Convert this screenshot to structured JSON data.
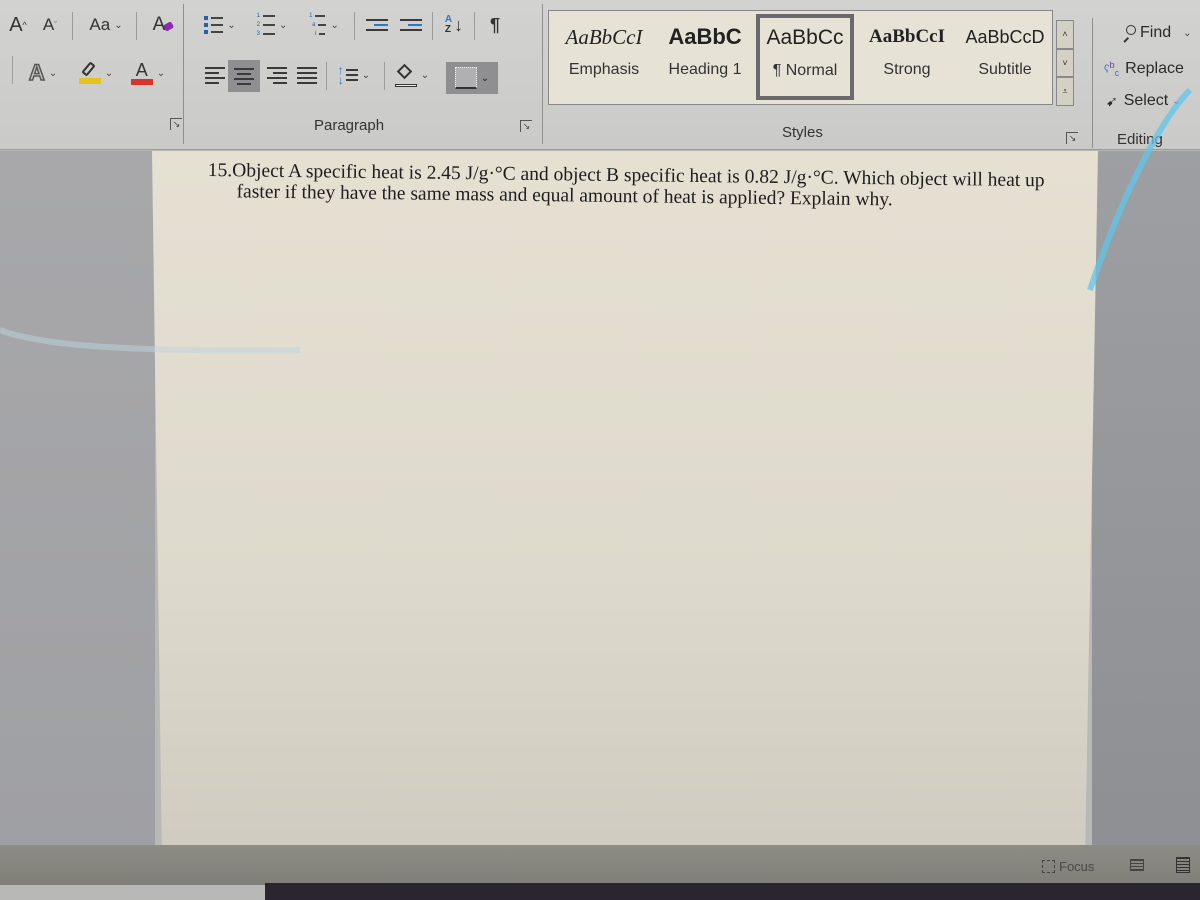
{
  "ribbon": {
    "font_group": {
      "grow_font": "A",
      "shrink_font": "A",
      "change_case": "Aa",
      "clear_formatting": "A",
      "text_effects": "A",
      "highlight_color": "#e6c21e",
      "font_color_letter": "A",
      "font_color": "#d9342b"
    },
    "paragraph_group": {
      "label": "Paragraph",
      "sort": "A Z ↓",
      "show_marks": "¶"
    },
    "styles_group": {
      "label": "Styles",
      "items": [
        {
          "preview": "AaBbCcI",
          "name": "Emphasis",
          "selected": false
        },
        {
          "preview": "AaBbC",
          "name": "Heading 1",
          "selected": false
        },
        {
          "preview": "AaBbCc",
          "name": "¶ Normal",
          "selected": true
        },
        {
          "preview": "AaBbCcI",
          "name": "Strong",
          "selected": false
        },
        {
          "preview": "AaBbCcD",
          "name": "Subtitle",
          "selected": false
        }
      ]
    },
    "editing_group": {
      "label": "Editing",
      "find": "Find",
      "replace": "Replace",
      "select": "Select"
    }
  },
  "document": {
    "question_number": "15.",
    "question_text": "Object A specific heat is 2.45 J/g·°C and object B specific heat is 0.82 J/g·°C. Which object will heat up faster if they have the same mass and equal amount of heat is applied? Explain why."
  },
  "status_bar": {
    "focus": "Focus"
  },
  "colors": {
    "ribbon_bg": "#cfcfcd",
    "page_bg": "#e3dfd1",
    "accent_blue": "#2a78c8"
  }
}
